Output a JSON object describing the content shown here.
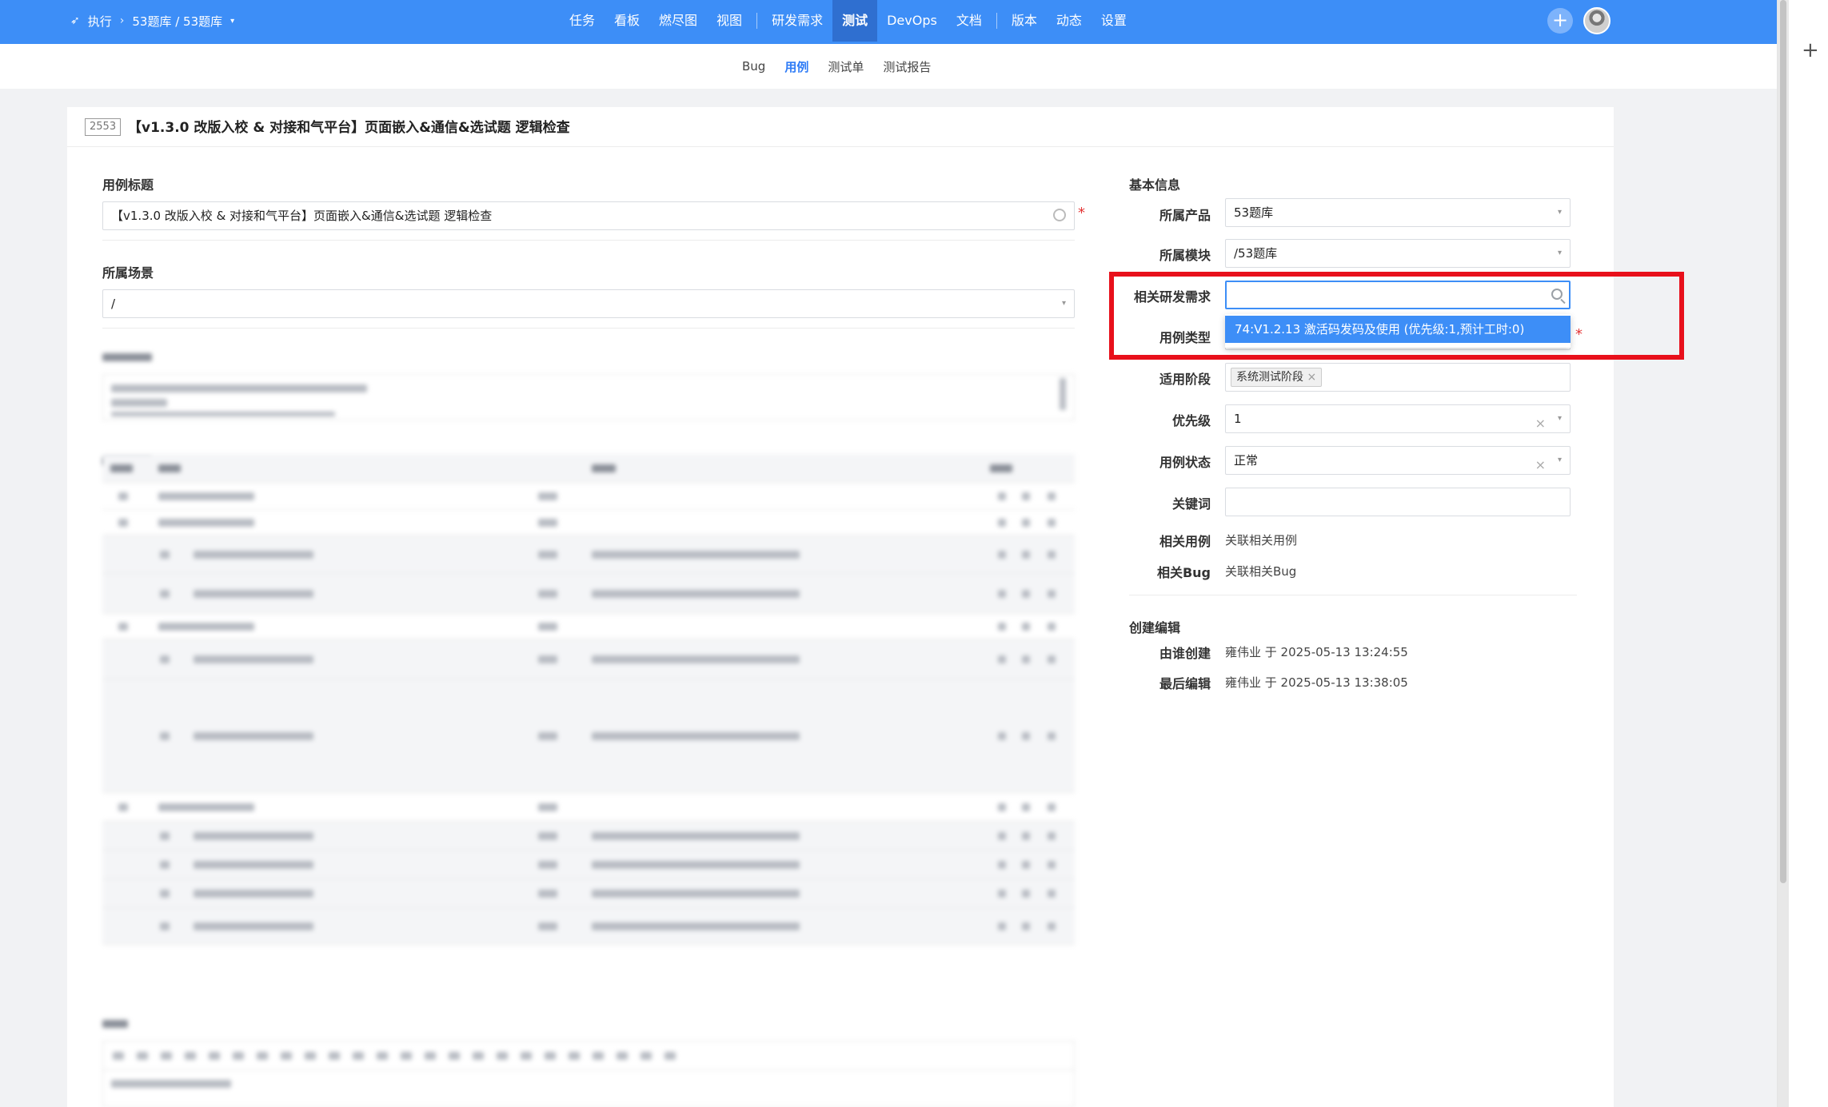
{
  "topbar": {
    "breadcrumb": {
      "exec_label": "执行",
      "product_label": "53题库 / 53题库"
    },
    "nav": [
      {
        "label": "任务",
        "active": false
      },
      {
        "label": "看板",
        "active": false
      },
      {
        "label": "燃尽图",
        "active": false
      },
      {
        "label": "视图",
        "active": false
      },
      {
        "label": "研发需求",
        "active": false
      },
      {
        "label": "测试",
        "active": true
      },
      {
        "label": "DevOps",
        "active": false
      },
      {
        "label": "文档",
        "active": false
      },
      {
        "label": "版本",
        "active": false
      },
      {
        "label": "动态",
        "active": false
      },
      {
        "label": "设置",
        "active": false
      }
    ],
    "add_icon": "plus-icon",
    "accent": "#3d8ef7"
  },
  "subnav": {
    "items": [
      {
        "label": "Bug",
        "active": false
      },
      {
        "label": "用例",
        "active": true
      },
      {
        "label": "测试单",
        "active": false
      },
      {
        "label": "测试报告",
        "active": false
      }
    ]
  },
  "case": {
    "id": "2553",
    "title": "【v1.3.0 改版入校 & 对接和气平台】页面嵌入&通信&选试题 逻辑检查"
  },
  "form": {
    "title_label": "用例标题",
    "title_value": "【v1.3.0 改版入校 & 对接和气平台】页面嵌入&通信&选试题 逻辑检查",
    "scene_label": "所属场景",
    "scene_value": "/"
  },
  "basic_info": {
    "heading": "基本信息",
    "product_label": "所属产品",
    "product_value": "53题库",
    "module_label": "所属模块",
    "module_value": "/53题库",
    "story_label": "相关研发需求",
    "story_search_value": "",
    "story_option": "74:V1.2.13 激活码发码及使用 (优先级:1,预计工时:0)",
    "type_label": "用例类型",
    "stage_label": "适用阶段",
    "stage_tag": "系统测试阶段",
    "pri_label": "优先级",
    "pri_value": "1",
    "status_label": "用例状态",
    "status_value": "正常",
    "keywords_label": "关键词",
    "keywords_value": "",
    "linkcase_label": "相关用例",
    "linkcase_value": "关联相关用例",
    "linkbug_label": "相关Bug",
    "linkbug_value": "关联相关Bug"
  },
  "create_edit": {
    "heading": "创建编辑",
    "created_label": "由谁创建",
    "created_value": "雍伟业 于 2025-05-13 13:24:55",
    "edited_label": "最后编辑",
    "edited_value": "雍伟业 于 2025-05-13 13:38:05"
  }
}
